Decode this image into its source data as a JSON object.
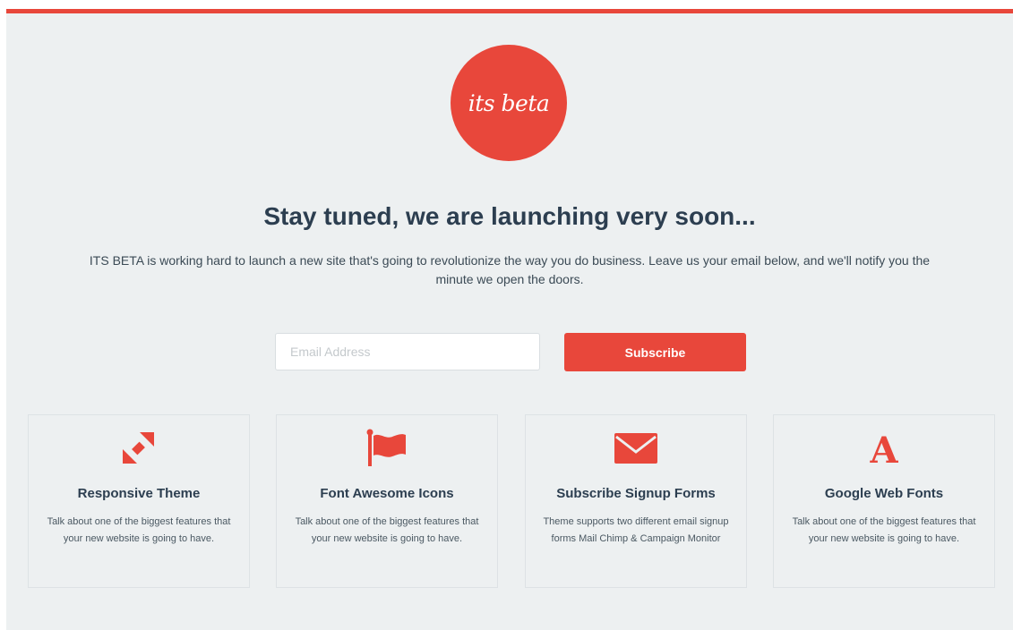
{
  "colors": {
    "accent": "#e8473b",
    "background": "#edf0f1",
    "heading": "#2c3e50"
  },
  "logo": {
    "text": "its beta"
  },
  "hero": {
    "headline": "Stay tuned, we are launching very soon...",
    "intro": "ITS BETA is working hard to launch a new site that's going to revolutionize the way you do business. Leave us your email below, and we'll notify you the minute we open the doors."
  },
  "signup": {
    "email_placeholder": "Email Address",
    "email_value": "",
    "subscribe_label": "Subscribe"
  },
  "features": [
    {
      "icon": "resize-arrows-icon",
      "title": "Responsive Theme",
      "description": "Talk about one of the biggest features that your new website is going to have."
    },
    {
      "icon": "flag-icon",
      "title": "Font Awesome Icons",
      "description": "Talk about one of the biggest features that your new website is going to have."
    },
    {
      "icon": "envelope-icon",
      "title": "Subscribe Signup Forms",
      "description": "Theme supports two different email signup forms Mail Chimp & Campaign Monitor"
    },
    {
      "icon": "font-a-icon",
      "title": "Google Web Fonts",
      "description": "Talk about one of the biggest features that your new website is going to have."
    }
  ]
}
